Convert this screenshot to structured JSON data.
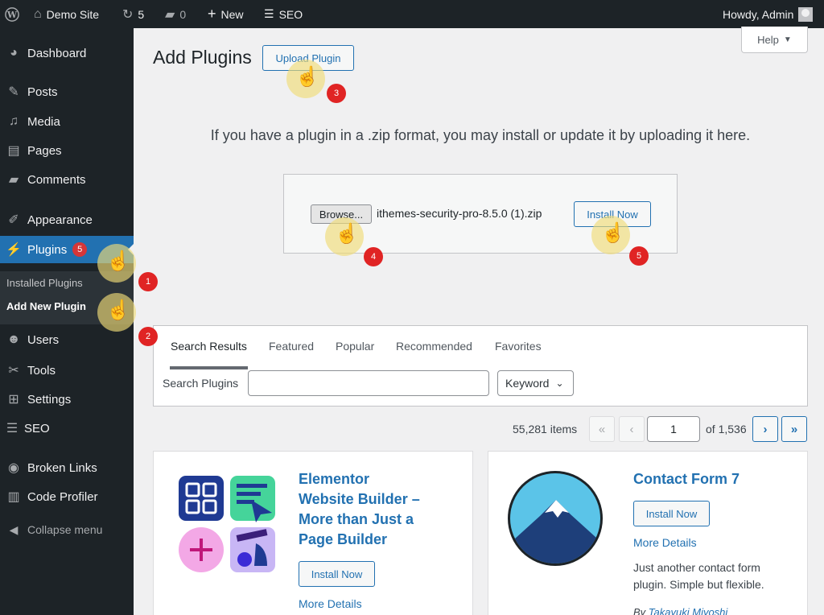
{
  "adminbar": {
    "site_name": "Demo Site",
    "updates_count": "5",
    "comments_count": "0",
    "new_label": "New",
    "seo_label": "SEO",
    "greeting": "Howdy, Admin"
  },
  "sidebar": {
    "items": [
      {
        "label": "Dashboard",
        "icon": "dashboard-icon"
      },
      {
        "label": "Posts",
        "icon": "pin-icon"
      },
      {
        "label": "Media",
        "icon": "media-icon"
      },
      {
        "label": "Pages",
        "icon": "pages-icon"
      },
      {
        "label": "Comments",
        "icon": "comment-icon"
      },
      {
        "label": "Appearance",
        "icon": "brush-icon"
      },
      {
        "label": "Plugins",
        "icon": "plug-icon",
        "badge": "5"
      },
      {
        "label": "Users",
        "icon": "user-icon"
      },
      {
        "label": "Tools",
        "icon": "wrench-icon"
      },
      {
        "label": "Settings",
        "icon": "settings-icon"
      },
      {
        "label": "SEO",
        "icon": "seo-icon"
      },
      {
        "label": "Broken Links",
        "icon": "link-icon"
      },
      {
        "label": "Code Profiler",
        "icon": "chart-icon"
      }
    ],
    "submenu": [
      "Installed Plugins",
      "Add New Plugin"
    ],
    "collapse_label": "Collapse menu"
  },
  "help_label": "Help",
  "page": {
    "title": "Add Plugins",
    "upload_button": "Upload Plugin",
    "upload_info": "If you have a plugin in a .zip format, you may install or update it by uploading it here.",
    "browse_button": "Browse...",
    "file_name": "ithemes-security-pro-8.5.0 (1).zip",
    "install_button": "Install Now"
  },
  "filter": {
    "tabs": [
      "Search Results",
      "Featured",
      "Popular",
      "Recommended",
      "Favorites"
    ],
    "search_label": "Search Plugins",
    "search_value": "",
    "select_value": "Keyword"
  },
  "pagination": {
    "items": "55,281 items",
    "first": "«",
    "prev": "‹",
    "current": "1",
    "of_label": "of 1,536",
    "next": "›",
    "last": "»"
  },
  "cards": [
    {
      "title_lines": [
        "Elementor",
        "Website Builder –",
        "More than Just a",
        "Page Builder"
      ],
      "install_label": "Install Now",
      "more_label": "More Details"
    },
    {
      "title": "Contact Form 7",
      "install_label": "Install Now",
      "more_label": "More Details",
      "desc_lines": [
        "Just another contact form",
        "plugin. Simple but flexible."
      ],
      "by_prefix": "By",
      "author": "Takayuki Miyoshi"
    }
  ],
  "annotations": [
    "1",
    "2",
    "3",
    "4",
    "5"
  ],
  "colors": {
    "admin_dark": "#1d2327",
    "accent_blue": "#2271b1",
    "badge_red": "#d63638",
    "step_red": "#e02424",
    "highlight_yellow": "#f0dc78"
  }
}
